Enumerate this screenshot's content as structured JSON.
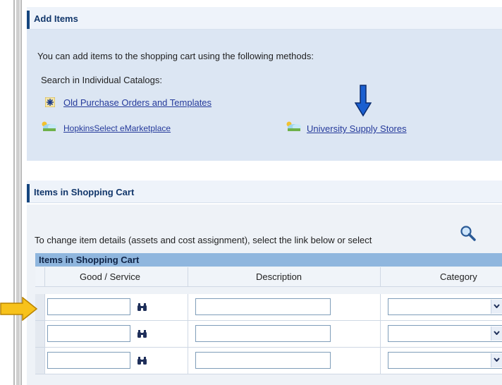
{
  "add_items": {
    "title": "Add Items",
    "intro": "You can add items to the shopping cart using the following methods:",
    "search_label": "Search in Individual Catalogs:",
    "link_old_po": "Old Purchase Orders and Templates",
    "link_hopkins": "HopkinsSelect eMarketplace",
    "link_supply": "University Supply Stores"
  },
  "cart": {
    "title": "Items in Shopping Cart",
    "instruction": "To change item details (assets and cost assignment), select the link below or select",
    "grid_title": "Items in Shopping Cart",
    "columns": [
      "Good / Service",
      "Description",
      "Category"
    ],
    "rows": [
      {
        "good_service": "",
        "description": "",
        "category": ""
      },
      {
        "good_service": "",
        "description": "",
        "category": ""
      },
      {
        "good_service": "",
        "description": "",
        "category": ""
      }
    ]
  },
  "annotations": {
    "blue_arrow_color": "#1a5fd0",
    "yellow_arrow_color": "#f7c21b"
  },
  "icons": [
    "catalog-star-icon",
    "cloud-catalog-icon",
    "magnifier-icon",
    "binoculars-icon",
    "chevron-down-icon"
  ]
}
